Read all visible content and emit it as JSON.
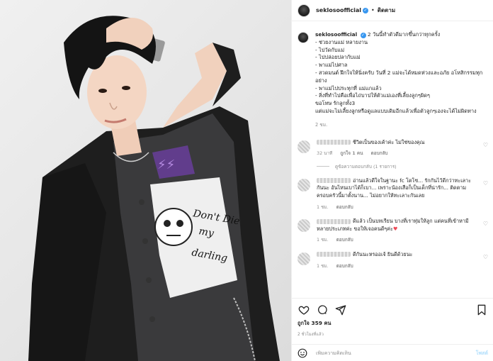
{
  "header": {
    "username": "seklosoofficial",
    "verified_icon": "verified-badge-icon",
    "separator": "•",
    "follow_label": "ติดตาม"
  },
  "caption": {
    "username": "seklosoofficial",
    "intro": "2 วันนี้ทำตัวดีมากขึ้นกว่าทุกครั้ง",
    "lines": [
      "- ช่วยงานแม่ หลายงาน",
      "- ไปวัดกับแม่",
      "- ไปปล่อยปลากับแม่",
      "- พาแม่ไปศาล",
      "- สวดมนต์ ฝึกใจให้นิ่งครับ วันที่ 2 แม่จะได้หมดห่วงและอภัย อโหสิกรรมทุกอย่าง",
      "- พาแม่ไปประทุกที่ แม่แกแล้ว",
      "- สิ่งที่ทำไปคือเพื่อไถ่บาปให้ตัวแม่เองที่เลี้ยงลูกๆผิดๆ",
      "ขอโทษ รักลูกทั้ง3",
      "แต่แม่จะไม่เลี้ยงลูกหรือดูแลแบบเดิมอีกแล้วเพื่อตัวลูกๆเองจะได้ไม่ผิดทาง"
    ],
    "time": "2 ชม."
  },
  "comments": [
    {
      "text": "ชีวิตเป็นของเค้าค่ะ ไม่ใช่ของคุณ",
      "meta_time": "32 นาที",
      "meta_likes": "ถูกใจ 1 คน",
      "meta_reply": "ตอบกลับ",
      "view_replies": "ดูข้อความตอบกลับ (1 รายการ)",
      "heart": "♡"
    },
    {
      "text": "อ่านแล้วดีใจในฐานะ fc โตโซ... รักกันไว้ดีกว่าทะเลาะกันนะ อันไหนเบาได้ก็เบา... เพราะน้องเสือก็เป็นเด็กที่น่ารัก... ติดตามครอบครัวนี้มาตั้งนาน... ไม่อยากให้ทะเลาะกันเลย",
      "meta_time": "1 ชม.",
      "meta_reply": "ตอบกลับ",
      "heart": "♡"
    },
    {
      "text": "ดีแล้ว เป็นบทเรียน บางที่เราทุ่มให้ลูก แต่คนที่เข้าหามีหลายประเภทค่ะ ขอให้เจอคนดีๆค่ะ",
      "redheart": "♥",
      "meta_time": "1 ชม.",
      "meta_reply": "ตอบกลับ",
      "heart": "♡"
    },
    {
      "text": "ดีกันนะหรออเจ้ ยินดีด้วยนะ",
      "meta_time": "1 ชม.",
      "meta_reply": "ตอบกลับ",
      "heart": "♡"
    }
  ],
  "actions": {
    "icons": [
      "heart-icon",
      "comment-icon",
      "share-icon",
      "save-icon"
    ],
    "likes": "ถูกใจ 359 คน",
    "age": "2 ชั่วโมงที่แล้ว"
  },
  "add_comment": {
    "placeholder": "เพิ่มความคิดเห็น",
    "post_label": "โพสต์"
  },
  "photo": {
    "shirt_text": "Don't Die my darling"
  }
}
